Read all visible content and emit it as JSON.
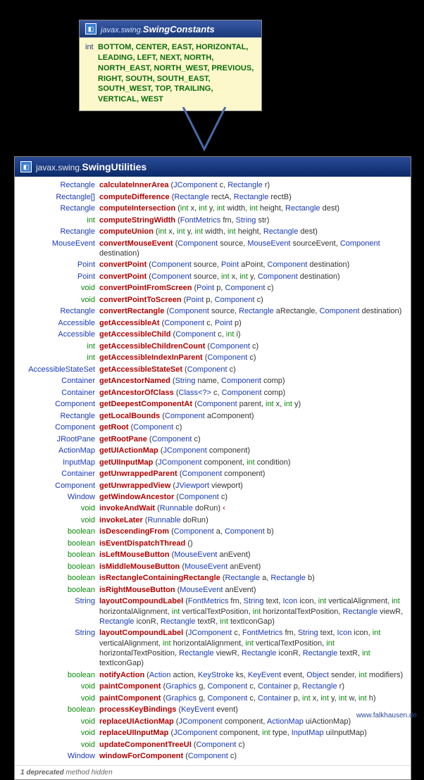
{
  "top": {
    "package": "javax.swing.",
    "class": "SwingConstants",
    "field_type": "int",
    "constants": "BOTTOM, CENTER, EAST, HORIZONTAL, LEADING, LEFT, NEXT, NORTH, NORTH_EAST, NORTH_WEST, PREVIOUS, RIGHT, SOUTH, SOUTH_EAST, SOUTH_WEST, TOP, TRAILING, VERTICAL, WEST"
  },
  "main": {
    "package": "javax.swing.",
    "class": "SwingUtilities",
    "methods": [
      {
        "ret": "Rectangle",
        "name": "calculateInnerArea",
        "params": [
          [
            "JComponent",
            "c"
          ],
          [
            "Rectangle",
            "r"
          ]
        ]
      },
      {
        "ret": "Rectangle[]",
        "name": "computeDifference",
        "params": [
          [
            "Rectangle",
            "rectA"
          ],
          [
            "Rectangle",
            "rectB"
          ]
        ]
      },
      {
        "ret": "Rectangle",
        "name": "computeIntersection",
        "params": [
          [
            "int",
            "x"
          ],
          [
            "int",
            "y"
          ],
          [
            "int",
            "width"
          ],
          [
            "int",
            "height"
          ],
          [
            "Rectangle",
            "dest"
          ]
        ]
      },
      {
        "ret": "int",
        "name": "computeStringWidth",
        "params": [
          [
            "FontMetrics",
            "fm"
          ],
          [
            "String",
            "str"
          ]
        ]
      },
      {
        "ret": "Rectangle",
        "name": "computeUnion",
        "params": [
          [
            "int",
            "x"
          ],
          [
            "int",
            "y"
          ],
          [
            "int",
            "width"
          ],
          [
            "int",
            "height"
          ],
          [
            "Rectangle",
            "dest"
          ]
        ]
      },
      {
        "ret": "MouseEvent",
        "name": "convertMouseEvent",
        "params": [
          [
            "Component",
            "source"
          ],
          [
            "MouseEvent",
            "sourceEvent"
          ],
          [
            "Component",
            "destination"
          ]
        ]
      },
      {
        "ret": "Point",
        "name": "convertPoint",
        "params": [
          [
            "Component",
            "source"
          ],
          [
            "Point",
            "aPoint"
          ],
          [
            "Component",
            "destination"
          ]
        ]
      },
      {
        "ret": "Point",
        "name": "convertPoint",
        "params": [
          [
            "Component",
            "source"
          ],
          [
            "int",
            "x"
          ],
          [
            "int",
            "y"
          ],
          [
            "Component",
            "destination"
          ]
        ]
      },
      {
        "ret": "void",
        "name": "convertPointFromScreen",
        "params": [
          [
            "Point",
            "p"
          ],
          [
            "Component",
            "c"
          ]
        ]
      },
      {
        "ret": "void",
        "name": "convertPointToScreen",
        "params": [
          [
            "Point",
            "p"
          ],
          [
            "Component",
            "c"
          ]
        ]
      },
      {
        "ret": "Rectangle",
        "name": "convertRectangle",
        "params": [
          [
            "Component",
            "source"
          ],
          [
            "Rectangle",
            "aRectangle"
          ],
          [
            "Component",
            "destination"
          ]
        ]
      },
      {
        "ret": "Accessible",
        "name": "getAccessibleAt",
        "params": [
          [
            "Component",
            "c"
          ],
          [
            "Point",
            "p"
          ]
        ]
      },
      {
        "ret": "Accessible",
        "name": "getAccessibleChild",
        "params": [
          [
            "Component",
            "c"
          ],
          [
            "int",
            "i"
          ]
        ]
      },
      {
        "ret": "int",
        "name": "getAccessibleChildrenCount",
        "params": [
          [
            "Component",
            "c"
          ]
        ]
      },
      {
        "ret": "int",
        "name": "getAccessibleIndexInParent",
        "params": [
          [
            "Component",
            "c"
          ]
        ]
      },
      {
        "ret": "AccessibleStateSet",
        "name": "getAccessibleStateSet",
        "params": [
          [
            "Component",
            "c"
          ]
        ]
      },
      {
        "ret": "Container",
        "name": "getAncestorNamed",
        "params": [
          [
            "String",
            "name"
          ],
          [
            "Component",
            "comp"
          ]
        ]
      },
      {
        "ret": "Container",
        "name": "getAncestorOfClass",
        "params": [
          [
            "Class<?>",
            "c"
          ],
          [
            "Component",
            "comp"
          ]
        ]
      },
      {
        "ret": "Component",
        "name": "getDeepestComponentAt",
        "params": [
          [
            "Component",
            "parent"
          ],
          [
            "int",
            "x"
          ],
          [
            "int",
            "y"
          ]
        ]
      },
      {
        "ret": "Rectangle",
        "name": "getLocalBounds",
        "params": [
          [
            "Component",
            "aComponent"
          ]
        ]
      },
      {
        "ret": "Component",
        "name": "getRoot",
        "params": [
          [
            "Component",
            "c"
          ]
        ]
      },
      {
        "ret": "JRootPane",
        "name": "getRootPane",
        "params": [
          [
            "Component",
            "c"
          ]
        ]
      },
      {
        "ret": "ActionMap",
        "name": "getUIActionMap",
        "params": [
          [
            "JComponent",
            "component"
          ]
        ]
      },
      {
        "ret": "InputMap",
        "name": "getUIInputMap",
        "params": [
          [
            "JComponent",
            "component"
          ],
          [
            "int",
            "condition"
          ]
        ]
      },
      {
        "ret": "Container",
        "name": "getUnwrappedParent",
        "params": [
          [
            "Component",
            "component"
          ]
        ]
      },
      {
        "ret": "Component",
        "name": "getUnwrappedView",
        "params": [
          [
            "JViewport",
            "viewport"
          ]
        ]
      },
      {
        "ret": "Window",
        "name": "getWindowAncestor",
        "params": [
          [
            "Component",
            "c"
          ]
        ]
      },
      {
        "ret": "void",
        "name": "invokeAndWait",
        "params": [
          [
            "Runnable",
            "doRun"
          ]
        ],
        "throws": true
      },
      {
        "ret": "void",
        "name": "invokeLater",
        "params": [
          [
            "Runnable",
            "doRun"
          ]
        ]
      },
      {
        "ret": "boolean",
        "name": "isDescendingFrom",
        "params": [
          [
            "Component",
            "a"
          ],
          [
            "Component",
            "b"
          ]
        ]
      },
      {
        "ret": "boolean",
        "name": "isEventDispatchThread",
        "params": []
      },
      {
        "ret": "boolean",
        "name": "isLeftMouseButton",
        "params": [
          [
            "MouseEvent",
            "anEvent"
          ]
        ]
      },
      {
        "ret": "boolean",
        "name": "isMiddleMouseButton",
        "params": [
          [
            "MouseEvent",
            "anEvent"
          ]
        ]
      },
      {
        "ret": "boolean",
        "name": "isRectangleContainingRectangle",
        "params": [
          [
            "Rectangle",
            "a"
          ],
          [
            "Rectangle",
            "b"
          ]
        ]
      },
      {
        "ret": "boolean",
        "name": "isRightMouseButton",
        "params": [
          [
            "MouseEvent",
            "anEvent"
          ]
        ]
      },
      {
        "ret": "String",
        "name": "layoutCompoundLabel",
        "params": [
          [
            "FontMetrics",
            "fm"
          ],
          [
            "String",
            "text"
          ],
          [
            "Icon",
            "icon"
          ],
          [
            "int",
            "verticalAlignment"
          ],
          [
            "int",
            "horizontalAlignment"
          ],
          [
            "int",
            "verticalTextPosition"
          ],
          [
            "int",
            "horizontalTextPosition"
          ],
          [
            "Rectangle",
            "viewR"
          ],
          [
            "Rectangle",
            "iconR"
          ],
          [
            "Rectangle",
            "textR"
          ],
          [
            "int",
            "textIconGap"
          ]
        ]
      },
      {
        "ret": "String",
        "name": "layoutCompoundLabel",
        "params": [
          [
            "JComponent",
            "c"
          ],
          [
            "FontMetrics",
            "fm"
          ],
          [
            "String",
            "text"
          ],
          [
            "Icon",
            "icon"
          ],
          [
            "int",
            "verticalAlignment"
          ],
          [
            "int",
            "horizontalAlignment"
          ],
          [
            "int",
            "verticalTextPosition"
          ],
          [
            "int",
            "horizontalTextPosition"
          ],
          [
            "Rectangle",
            "viewR"
          ],
          [
            "Rectangle",
            "iconR"
          ],
          [
            "Rectangle",
            "textR"
          ],
          [
            "int",
            "textIconGap"
          ]
        ]
      },
      {
        "ret": "boolean",
        "name": "notifyAction",
        "params": [
          [
            "Action",
            "action"
          ],
          [
            "KeyStroke",
            "ks"
          ],
          [
            "KeyEvent",
            "event"
          ],
          [
            "Object",
            "sender"
          ],
          [
            "int",
            "modifiers"
          ]
        ]
      },
      {
        "ret": "void",
        "name": "paintComponent",
        "params": [
          [
            "Graphics",
            "g"
          ],
          [
            "Component",
            "c"
          ],
          [
            "Container",
            "p"
          ],
          [
            "Rectangle",
            "r"
          ]
        ]
      },
      {
        "ret": "void",
        "name": "paintComponent",
        "params": [
          [
            "Graphics",
            "g"
          ],
          [
            "Component",
            "c"
          ],
          [
            "Container",
            "p"
          ],
          [
            "int",
            "x"
          ],
          [
            "int",
            "y"
          ],
          [
            "int",
            "w"
          ],
          [
            "int",
            "h"
          ]
        ]
      },
      {
        "ret": "boolean",
        "name": "processKeyBindings",
        "params": [
          [
            "KeyEvent",
            "event"
          ]
        ]
      },
      {
        "ret": "void",
        "name": "replaceUIActionMap",
        "params": [
          [
            "JComponent",
            "component"
          ],
          [
            "ActionMap",
            "uiActionMap"
          ]
        ]
      },
      {
        "ret": "void",
        "name": "replaceUIInputMap",
        "params": [
          [
            "JComponent",
            "component"
          ],
          [
            "int",
            "type"
          ],
          [
            "InputMap",
            "uiInputMap"
          ]
        ]
      },
      {
        "ret": "void",
        "name": "updateComponentTreeUI",
        "params": [
          [
            "Component",
            "c"
          ]
        ]
      },
      {
        "ret": "Window",
        "name": "windowForComponent",
        "params": [
          [
            "Component",
            "c"
          ]
        ]
      }
    ],
    "footnote_bold": "1 deprecated",
    "footnote_rest": " method hidden"
  },
  "credit": "www.falkhausen.de"
}
